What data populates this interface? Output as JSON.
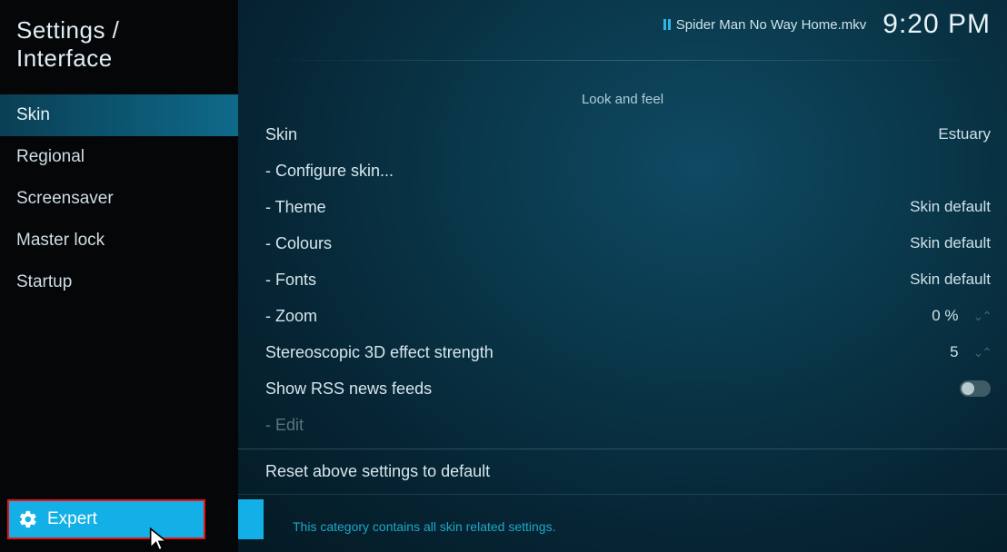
{
  "header": {
    "title": "Settings / Interface"
  },
  "topbar": {
    "now_playing": "Spider Man No Way Home.mkv",
    "clock": "9:20 PM"
  },
  "sidebar": {
    "items": [
      {
        "label": "Skin",
        "active": true
      },
      {
        "label": "Regional",
        "active": false
      },
      {
        "label": "Screensaver",
        "active": false
      },
      {
        "label": "Master lock",
        "active": false
      },
      {
        "label": "Startup",
        "active": false
      }
    ],
    "level": {
      "label": "Expert"
    }
  },
  "section": {
    "title": "Look and feel"
  },
  "settings": {
    "skin": {
      "label": "Skin",
      "value": "Estuary"
    },
    "configure": {
      "label": "Configure skin..."
    },
    "theme": {
      "label": "Theme",
      "value": "Skin default"
    },
    "colours": {
      "label": "Colours",
      "value": "Skin default"
    },
    "fonts": {
      "label": "Fonts",
      "value": "Skin default"
    },
    "zoom": {
      "label": "Zoom",
      "value": "0 %"
    },
    "stereo": {
      "label": "Stereoscopic 3D effect strength",
      "value": "5"
    },
    "rss": {
      "label": "Show RSS news feeds"
    },
    "edit": {
      "label": "Edit"
    },
    "reset": {
      "label": "Reset above settings to default"
    }
  },
  "hint": "This category contains all skin related settings."
}
